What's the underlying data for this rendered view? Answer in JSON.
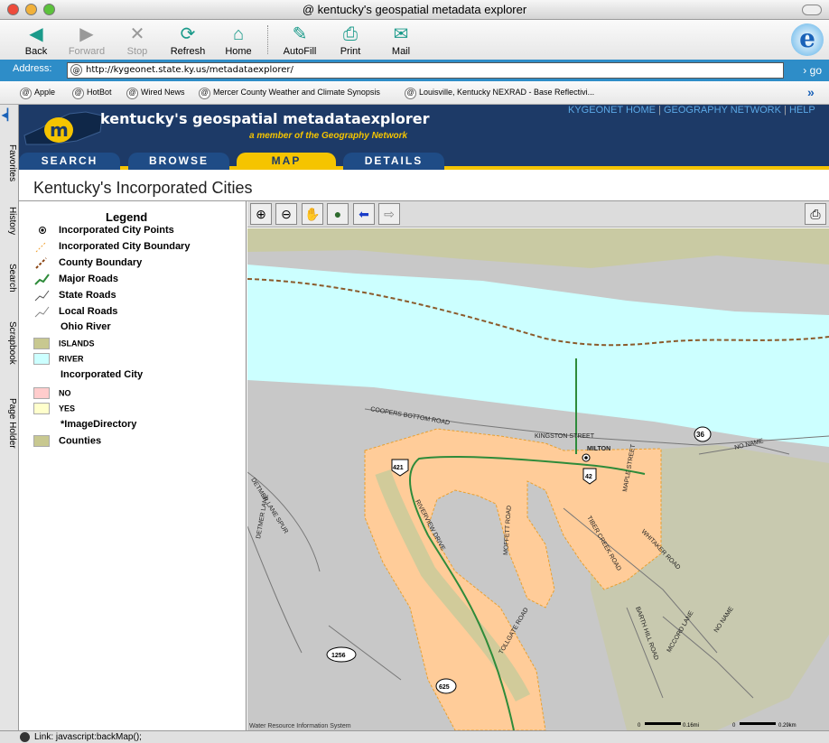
{
  "window": {
    "title": "kentucky's geospatial metadata explorer"
  },
  "toolbar": {
    "back": "Back",
    "forward": "Forward",
    "stop": "Stop",
    "refresh": "Refresh",
    "home": "Home",
    "autofill": "AutoFill",
    "print": "Print",
    "mail": "Mail"
  },
  "address": {
    "label": "Address:",
    "url": "http://kygeonet.state.ky.us/metadataexplorer/",
    "go": "go"
  },
  "favorites": [
    "Apple",
    "HotBot",
    "Wired News",
    "Mercer County Weather and Climate Synopsis",
    "Louisville,  Kentucky  NEXRAD - Base Reflectivi..."
  ],
  "sidetabs": [
    "Favorites",
    "History",
    "Search",
    "Scrapbook",
    "Page Holder"
  ],
  "site": {
    "brand": "kentucky's geospatial metadataexplorer",
    "member": "a member of the Geography Network",
    "links": [
      "KYGEONET HOME",
      "GEOGRAPHY NETWORK",
      "HELP"
    ],
    "tabs": [
      "SEARCH",
      "BROWSE",
      "MAP",
      "DETAILS"
    ],
    "active_tab": "MAP"
  },
  "page_title": "Kentucky's Incorporated Cities",
  "legend": {
    "title": "Legend",
    "items": [
      "Incorporated City Points",
      "Incorporated City Boundary",
      "County Boundary",
      "Major Roads",
      "State Roads",
      "Local Roads",
      "Ohio River"
    ],
    "islands": "ISLANDS",
    "river": "RIVER",
    "inc_city": "Incorporated City",
    "no": "NO",
    "yes": "YES",
    "imagedir": "*ImageDirectory",
    "counties": "Counties"
  },
  "map": {
    "labels": {
      "coopers": "COOPERS BOTTOM ROAD",
      "kingston": "KINGSTON STREET",
      "milton": "MILTON",
      "noname1": "NO NAME",
      "noname2": "NO NAME",
      "maple": "MAPLE STREET",
      "riverview": "RIVERVIEW DRIVE",
      "moffett": "MOFFETT ROAD",
      "tiber": "TIBER CREEK ROAD",
      "whitaker": "WHITAKER ROAD",
      "detmerspur": "DETMER LANE SPUR",
      "detmer": "DETMER LANE",
      "tollgate": "TOLLGATE ROAD",
      "barth": "BARTH HILL ROAD",
      "mccord": "MCCORD LANE"
    },
    "shields": {
      "s36": "36",
      "s421": "421",
      "s42": "42",
      "s1256": "1256",
      "s625": "625"
    },
    "credit": "Water Resource Information System",
    "scale1": "0.16mi",
    "scale2": "0.29km",
    "zero": "0"
  },
  "status": "Link: javascript:backMap();",
  "colors": {
    "banner": "#1d3a67",
    "accent": "#f5c400",
    "river": "#ccffff",
    "city": "#ffcc99",
    "land": "#c8c8c8"
  }
}
